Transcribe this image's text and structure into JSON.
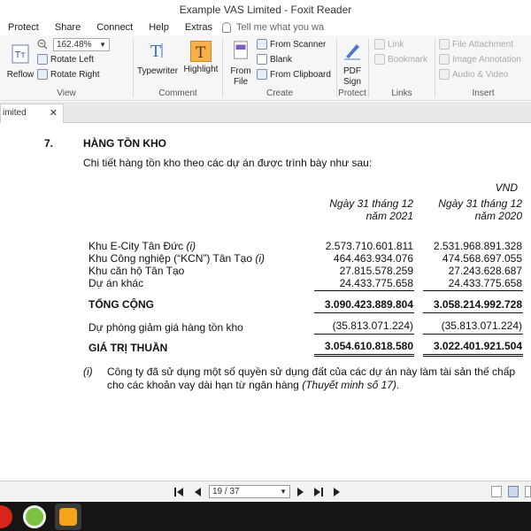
{
  "window": {
    "title": "Example VAS Limited - Foxit Reader"
  },
  "menu": {
    "items": [
      "Protect",
      "Share",
      "Connect",
      "Help",
      "Extras"
    ],
    "tell_me": "Tell me what you wa"
  },
  "ribbon": {
    "view": {
      "reflow": "Reflow",
      "zoom": "162.48%",
      "rotate_left": "Rotate Left",
      "rotate_right": "Rotate Right",
      "label": "View"
    },
    "comment": {
      "typewriter": "Typewriter",
      "highlight": "Highlight",
      "label": "Comment"
    },
    "create": {
      "from_file": "From\nFile",
      "from_file_l1": "From",
      "from_file_l2": "File",
      "from_scanner": "From Scanner",
      "blank": "Blank",
      "from_clipboard": "From Clipboard",
      "label": "Create"
    },
    "protect": {
      "pdf_sign_l1": "PDF",
      "pdf_sign_l2": "Sign",
      "label": "Protect"
    },
    "links": {
      "link": "Link",
      "bookmark": "Bookmark",
      "label": "Links"
    },
    "insert": {
      "file_attachment": "File Attachment",
      "image_annotation": "Image Annotation",
      "audio_video": "Audio & Video",
      "label": "Insert"
    }
  },
  "tab": {
    "label": "imited"
  },
  "document": {
    "section_number": "7.",
    "section_title": "HÀNG TỒN KHO",
    "intro": "Chi tiết hàng tồn kho theo các dự án được trình bày như sau:",
    "unit": "VND",
    "col1_l1": "Ngày 31 tháng 12",
    "col1_l2": "năm 2021",
    "col2_l1": "Ngày 31 tháng 12",
    "col2_l2": "năm 2020",
    "rows": [
      {
        "label": "Khu E-City Tân Đức",
        "note": " (i)",
        "v2021": "2.573.710.601.811",
        "v2020": "2.531.968.891.328"
      },
      {
        "label": "Khu Công nghiệp (“KCN”) Tân Tạo",
        "note": " (i)",
        "v2021": "464.463.934.076",
        "v2020": "474.568.697.055"
      },
      {
        "label": "Khu căn hộ Tân Tạo",
        "note": "",
        "v2021": "27.815.578.259",
        "v2020": "27.243.628.687"
      },
      {
        "label": "Dự án khác",
        "note": "",
        "v2021": "24.433.775.658",
        "v2020": "24.433.775.658"
      }
    ],
    "total": {
      "label": "TỔNG CỘNG",
      "v2021": "3.090.423.889.804",
      "v2020": "3.058.214.992.728"
    },
    "provision": {
      "label": "Dự phòng giảm giá hàng tồn kho",
      "v2021": "(35.813.071.224)",
      "v2020": "(35.813.071.224)"
    },
    "net": {
      "label": "GIÁ TRỊ THUẦN",
      "v2021": "3.054.610.818.580",
      "v2020": "3.022.401.921.504"
    },
    "note_marker": "(i)",
    "note_text": "Công ty đã sử dụng một số quyền sử dụng đất của các dự án này làm tài sản thế chấp cho các khoản vay dài hạn từ ngân hàng ",
    "note_ref": "(Thuyết minh số 17)",
    "note_end": "."
  },
  "nav": {
    "page": "19 / 37"
  },
  "colors": {
    "accent": "#f7a21b",
    "taskbar": "#151515"
  }
}
